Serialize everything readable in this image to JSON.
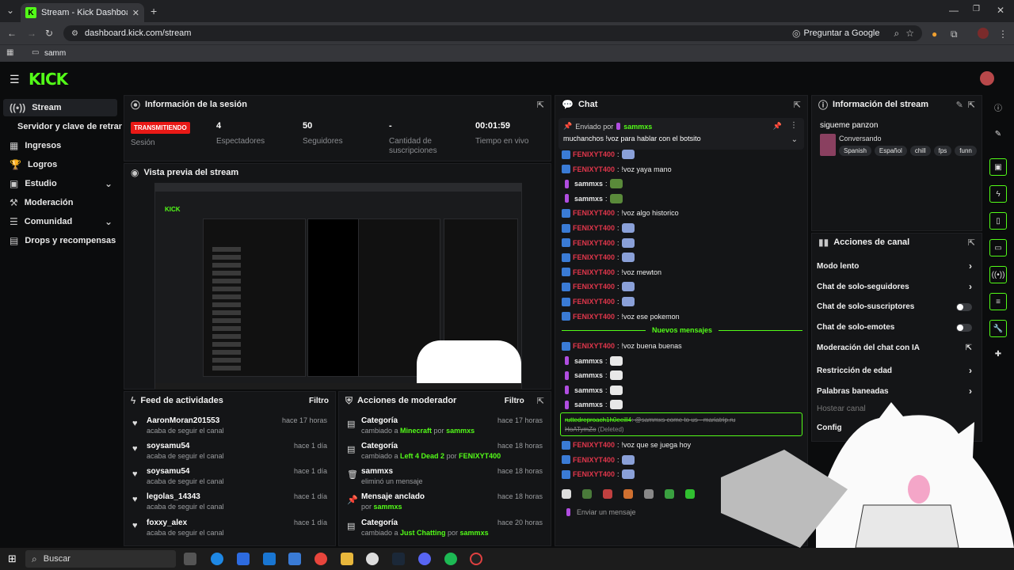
{
  "browser": {
    "tab_title": "Stream - Kick Dashboard",
    "url": "dashboard.kick.com/stream",
    "ask_google": "Preguntar a Google",
    "bookmark": "samm"
  },
  "sidebar": {
    "items": [
      {
        "label": "Stream",
        "icon": "broadcast-icon"
      },
      {
        "label": "Servidor y clave de retransmisión"
      },
      {
        "label": "Ingresos",
        "icon": "chart-icon"
      },
      {
        "label": "Logros",
        "icon": "trophy-icon"
      },
      {
        "label": "Estudio",
        "icon": "studio-icon"
      },
      {
        "label": "Moderación",
        "icon": "hammer-icon"
      },
      {
        "label": "Comunidad",
        "icon": "community-icon"
      },
      {
        "label": "Drops y recompensas",
        "icon": "gift-icon"
      }
    ]
  },
  "session": {
    "title": "Información de la sesión",
    "status_badge": "TRANSMITIENDO",
    "status_label": "Sesión",
    "viewers_value": "4",
    "viewers_label": "Espectadores",
    "followers_value": "50",
    "followers_label": "Seguidores",
    "subs_value": "-",
    "subs_label": "Cantidad de suscripciones",
    "live_value": "00:01:59",
    "live_label": "Tiempo en vivo"
  },
  "preview": {
    "title": "Vista previa del stream"
  },
  "activity": {
    "title": "Feed de actividades",
    "filter": "Filtro",
    "rows": [
      {
        "name": "AaronMoran201553",
        "sub": "acaba de seguir el canal",
        "time": "hace 17 horas"
      },
      {
        "name": "soysamu54",
        "sub": "acaba de seguir el canal",
        "time": "hace 1 día"
      },
      {
        "name": "soysamu54",
        "sub": "acaba de seguir el canal",
        "time": "hace 1 día"
      },
      {
        "name": "legolas_14343",
        "sub": "acaba de seguir el canal",
        "time": "hace 1 día"
      },
      {
        "name": "foxxy_alex",
        "sub": "acaba de seguir el canal",
        "time": "hace 1 día"
      }
    ]
  },
  "modactions": {
    "title": "Acciones de moderador",
    "filter": "Filtro",
    "rows": [
      {
        "name": "Categoría",
        "pre": "cambiado a ",
        "hl": "Minecraft",
        "mid": " por ",
        "by": "sammxs",
        "time": "hace 17 horas"
      },
      {
        "name": "Categoría",
        "pre": "cambiado a ",
        "hl": "Left 4 Dead 2",
        "mid": " por ",
        "by": "FENIXYT400",
        "time": "hace 18 horas"
      },
      {
        "name": "sammxs",
        "pre": "eliminó un mensaje",
        "hl": "",
        "mid": "",
        "by": "",
        "time": "hace 18 horas"
      },
      {
        "name": "Mensaje anclado",
        "pre": "por ",
        "hl": "",
        "mid": "",
        "by": "sammxs",
        "time": "hace 18 horas"
      },
      {
        "name": "Categoría",
        "pre": "cambiado a ",
        "hl": "Just Chatting",
        "mid": " por ",
        "by": "sammxs",
        "time": "hace 20 horas"
      }
    ]
  },
  "chat": {
    "title": "Chat",
    "pinned_by_label": "Enviado por",
    "pinned_by": "sammxs",
    "pinned_msg": "muchanchos !voz para hablar con el botsito",
    "new_messages": "Nuevos mensajes",
    "input_placeholder": "Enviar un mensaje",
    "lines": [
      {
        "user": "FENIXYT400",
        "kind": "fenix",
        "msg": ""
      },
      {
        "user": "FENIXYT400",
        "kind": "fenix",
        "msg": "!voz yaya mano"
      },
      {
        "user": "sammxs",
        "kind": "sam",
        "msg": ""
      },
      {
        "user": "sammxs",
        "kind": "sam",
        "msg": ""
      },
      {
        "user": "FENIXYT400",
        "kind": "fenix",
        "msg": "!voz algo historico"
      },
      {
        "user": "FENIXYT400",
        "kind": "fenix",
        "msg": ""
      },
      {
        "user": "FENIXYT400",
        "kind": "fenix",
        "msg": ""
      },
      {
        "user": "FENIXYT400",
        "kind": "fenix",
        "msg": ""
      },
      {
        "user": "FENIXYT400",
        "kind": "fenix",
        "msg": "!voz mewton"
      },
      {
        "user": "FENIXYT400",
        "kind": "fenix",
        "msg": ""
      },
      {
        "user": "FENIXYT400",
        "kind": "fenix",
        "msg": ""
      },
      {
        "user": "FENIXYT400",
        "kind": "fenix",
        "msg": "!voz ese pokemon"
      }
    ],
    "lines_after": [
      {
        "user": "FENIXYT400",
        "kind": "fenix",
        "msg": "!voz buena buenas"
      },
      {
        "user": "sammxs",
        "kind": "sam",
        "msg": ""
      },
      {
        "user": "sammxs",
        "kind": "sam",
        "msg": ""
      },
      {
        "user": "sammxs",
        "kind": "sam",
        "msg": ""
      },
      {
        "user": "sammxs",
        "kind": "sam",
        "msg": ""
      }
    ],
    "deleted_user": "ruttedreproach1h0eeill4",
    "deleted_msg": "@sammxs come to us - mariatrip.ru",
    "deleted_msg2": "HoATymZo",
    "deleted_tag": "(Deleted)",
    "lines_end": [
      {
        "user": "FENIXYT400",
        "kind": "fenix",
        "msg": "!voz que se juega hoy"
      },
      {
        "user": "FENIXYT400",
        "kind": "fenix",
        "msg": ""
      },
      {
        "user": "FENIXYT400",
        "kind": "fenix",
        "msg": ""
      }
    ]
  },
  "streaminfo": {
    "title": "Información del stream",
    "stream_title": "sigueme panzon",
    "category": "Conversando",
    "tags": [
      "Spanish",
      "Español",
      "chill",
      "fps",
      "funn"
    ]
  },
  "channel": {
    "title": "Acciones de canal",
    "items": [
      {
        "label": "Modo lento",
        "ctrl": "chevron"
      },
      {
        "label": "Chat de solo-seguidores",
        "ctrl": "chevron"
      },
      {
        "label": "Chat de solo-suscriptores",
        "ctrl": "toggle"
      },
      {
        "label": "Chat de solo-emotes",
        "ctrl": "toggle"
      },
      {
        "label": "Moderación del chat con IA",
        "ctrl": "external"
      },
      {
        "label": "Restricción de edad",
        "ctrl": "chevron"
      },
      {
        "label": "Palabras baneadas",
        "ctrl": "chevron"
      },
      {
        "label": "Hostear canal",
        "ctrl": "none"
      },
      {
        "label": "Config",
        "ctrl": "chevron"
      }
    ]
  },
  "taskbar": {
    "search": "Buscar"
  },
  "colors": {
    "accent": "#53fc18",
    "live": "#e91916",
    "fenix": "#e0364b",
    "panel": "#141517"
  }
}
